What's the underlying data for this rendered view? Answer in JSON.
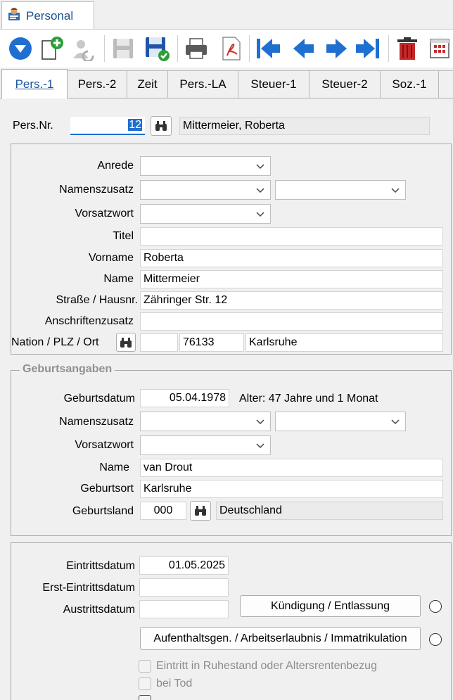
{
  "window": {
    "tab_title": "Personal"
  },
  "tabs": [
    {
      "label": "Pers.-1"
    },
    {
      "label": "Pers.-2"
    },
    {
      "label": "Zeit"
    },
    {
      "label": "Pers.-LA"
    },
    {
      "label": "Steuer-1"
    },
    {
      "label": "Steuer-2"
    },
    {
      "label": "Soz.-1"
    }
  ],
  "header": {
    "persnr_label": "Pers.Nr.",
    "persnr_value": "12",
    "person_name": "Mittermeier, Roberta"
  },
  "person": {
    "anrede_label": "Anrede",
    "namenszusatz_label": "Namenszusatz",
    "vorsatzwort_label": "Vorsatzwort",
    "titel_label": "Titel",
    "titel_value": "",
    "vorname_label": "Vorname",
    "vorname_value": "Roberta",
    "name_label": "Name",
    "name_value": "Mittermeier",
    "strasse_label": "Straße / Hausnr.",
    "strasse_value": "Zähringer Str. 12",
    "anschriftenzusatz_label": "Anschriftenzusatz",
    "anschriftenzusatz_value": "",
    "nation_label": "Nation / PLZ / Ort",
    "nation_value": "",
    "plz_value": "76133",
    "ort_value": "Karlsruhe"
  },
  "birth": {
    "group_title": "Geburtsangaben",
    "geburtsdatum_label": "Geburtsdatum",
    "geburtsdatum_value": "05.04.1978",
    "alter_text": "Alter: 47 Jahre und 1 Monat",
    "namenszusatz_label": "Namenszusatz",
    "vorsatzwort_label": "Vorsatzwort",
    "name_label": "Name",
    "name_value": "van Drout",
    "geburtsort_label": "Geburtsort",
    "geburtsort_value": "Karlsruhe",
    "geburtsland_label": "Geburtsland",
    "geburtsland_code": "000",
    "geburtsland_name": "Deutschland"
  },
  "employment": {
    "eintritt_label": "Eintrittsdatum",
    "eintritt_value": "01.05.2025",
    "ersteintritt_label": "Erst-Eintrittsdatum",
    "ersteintritt_value": "",
    "austritt_label": "Austrittsdatum",
    "austritt_value": "",
    "kuendigung_button": "Kündigung / Entlassung",
    "aufenthalt_button": "Aufenthaltsgen. / Arbeitserlaubnis / Immatrikulation",
    "ruhestand_label": "Eintritt in Ruhestand oder Altersrentenbezug",
    "tod_label": "bei Tod"
  },
  "colors": {
    "accent": "#1f6fd1",
    "toolbar_blue": "#1f6fd1",
    "delete_red": "#c62828",
    "ok_green": "#2e9e3a"
  }
}
